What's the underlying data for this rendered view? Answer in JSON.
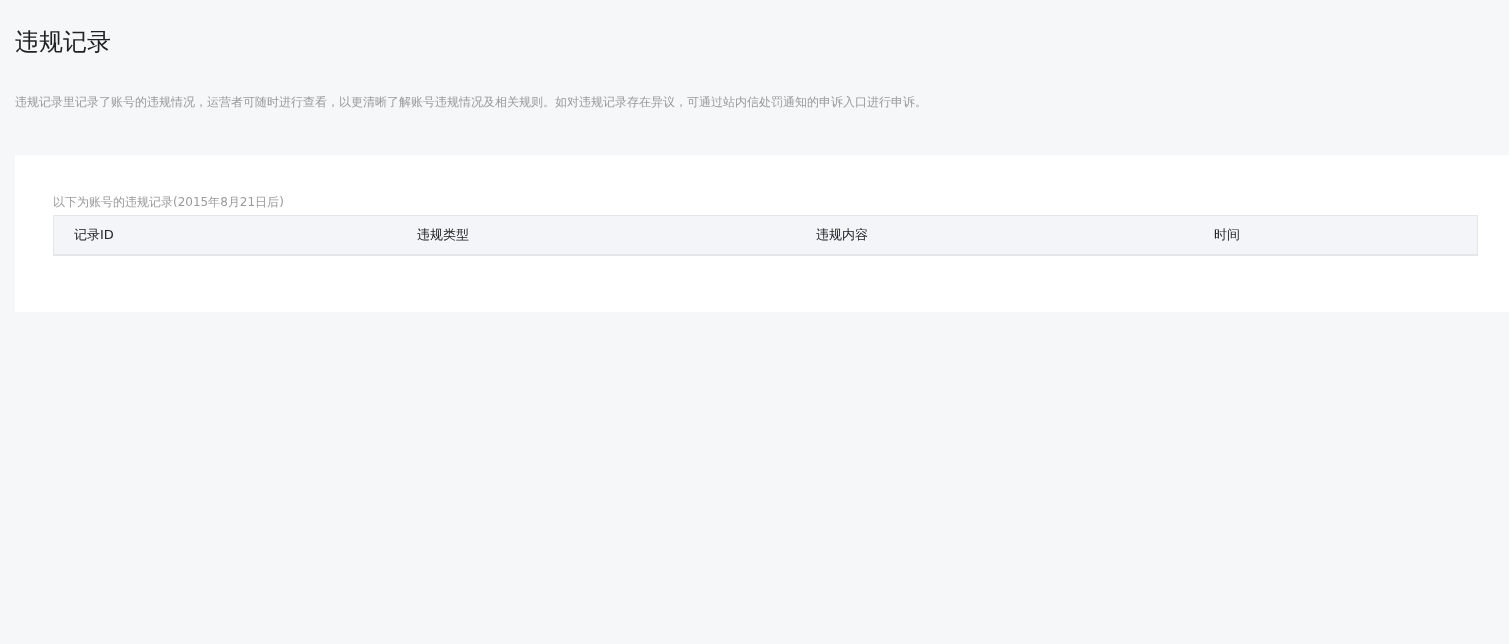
{
  "page": {
    "title": "违规记录",
    "description": "违规记录里记录了账号的违规情况，运营者可随时进行查看，以更清晰了解账号违规情况及相关规则。如对违规记录存在异议，可通过站内信处罚通知的申诉入口进行申诉。"
  },
  "records": {
    "caption": "以下为账号的违规记录(2015年8月21日后)",
    "columns": [
      "记录ID",
      "违规类型",
      "违规内容",
      "时间"
    ]
  }
}
